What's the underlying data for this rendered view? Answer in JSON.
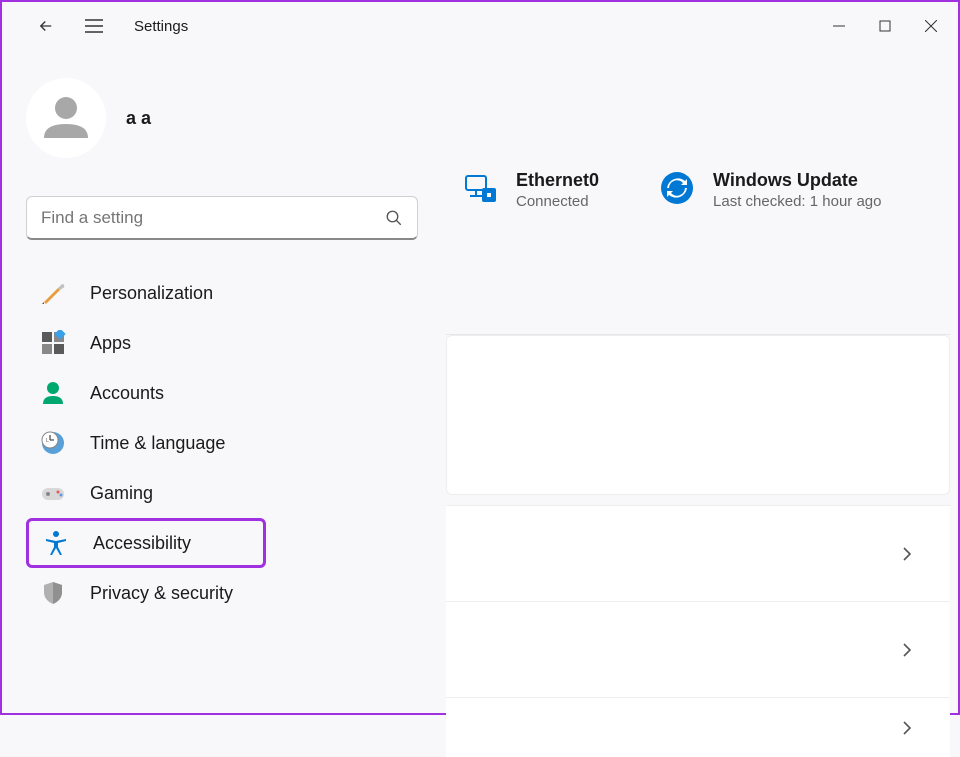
{
  "titlebar": {
    "app_title": "Settings"
  },
  "user": {
    "name": "a a",
    "email_placeholder": "                        "
  },
  "search": {
    "placeholder": "Find a setting"
  },
  "sidebar": {
    "items": [
      {
        "label": "Personalization",
        "icon": "personalization-icon"
      },
      {
        "label": "Apps",
        "icon": "apps-icon"
      },
      {
        "label": "Accounts",
        "icon": "accounts-icon"
      },
      {
        "label": "Time & language",
        "icon": "time-language-icon"
      },
      {
        "label": "Gaming",
        "icon": "gaming-icon"
      },
      {
        "label": "Accessibility",
        "icon": "accessibility-icon",
        "highlighted": true
      },
      {
        "label": "Privacy & security",
        "icon": "privacy-icon"
      }
    ]
  },
  "status": {
    "network": {
      "title": "Ethernet0",
      "subtitle": "Connected"
    },
    "update": {
      "title": "Windows Update",
      "subtitle": "Last checked: 1 hour ago"
    }
  },
  "colors": {
    "accent_blue": "#0078d4",
    "highlight_purple": "#a030e0",
    "icon_teal": "#00a870"
  }
}
